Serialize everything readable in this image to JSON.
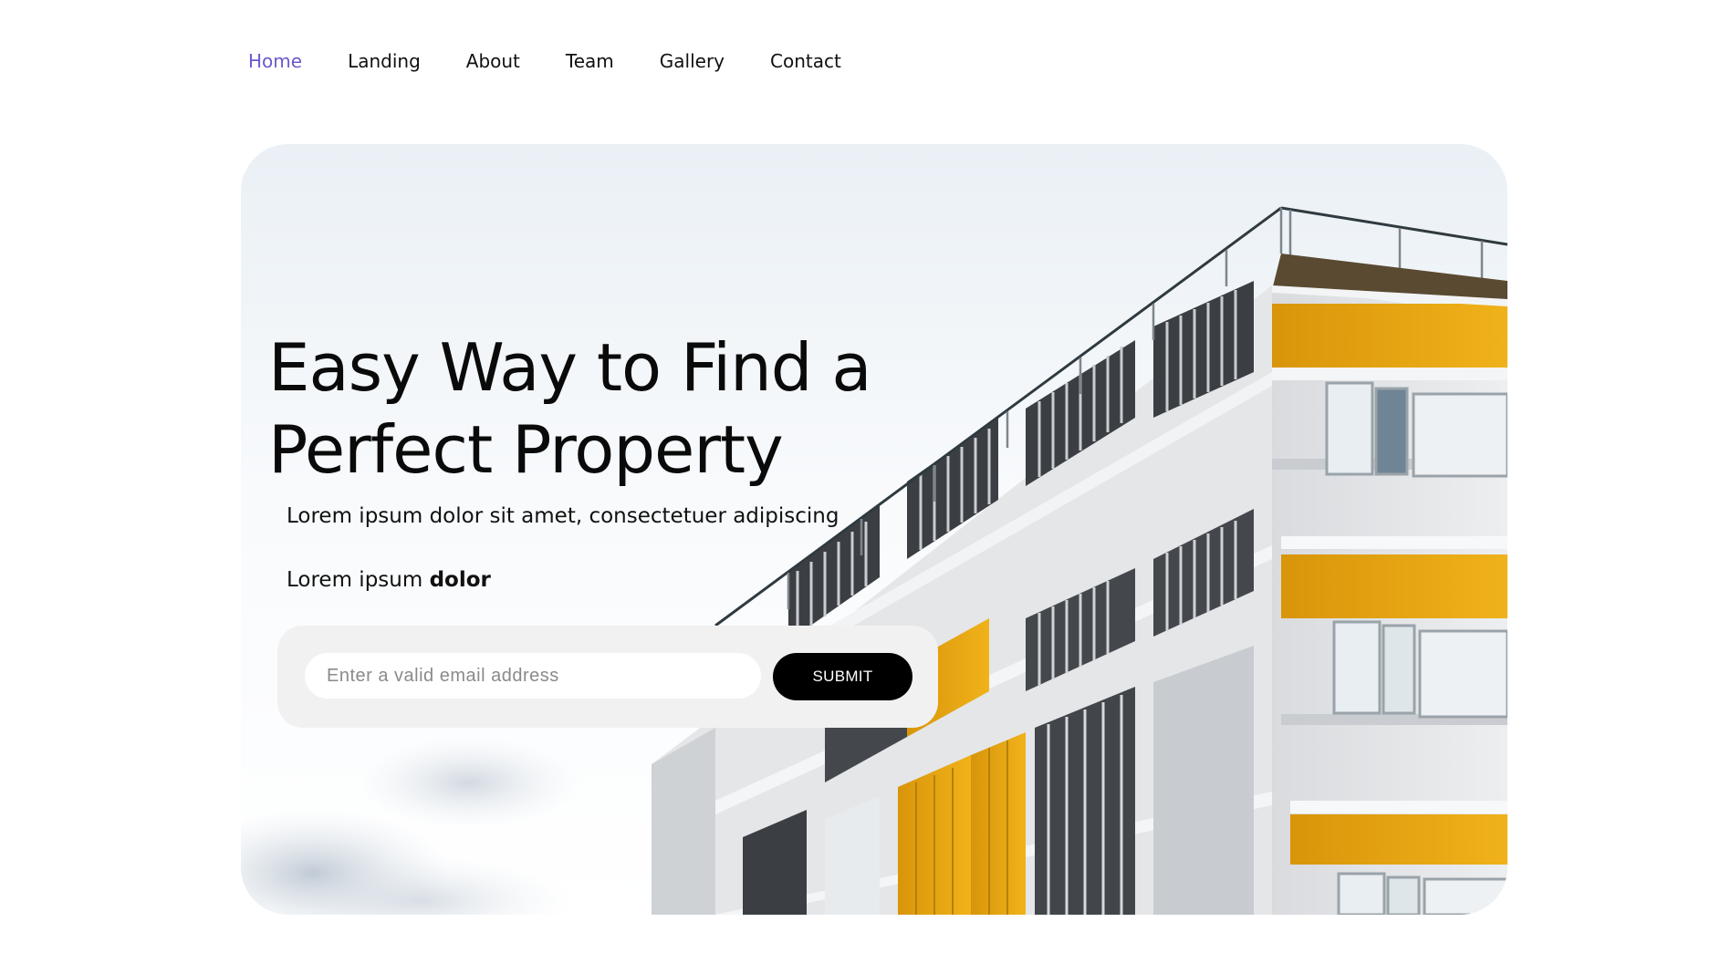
{
  "nav": {
    "items": [
      {
        "label": "Home",
        "active": true
      },
      {
        "label": "Landing",
        "active": false
      },
      {
        "label": "About",
        "active": false
      },
      {
        "label": "Team",
        "active": false
      },
      {
        "label": "Gallery",
        "active": false
      },
      {
        "label": "Contact",
        "active": false
      }
    ],
    "active_color": "#6a5acd"
  },
  "hero": {
    "title_line1": "Easy Way to Find a",
    "title_line2": "Perfect Property",
    "subtitle": "Lorem ipsum dolor sit amet, consectetuer adipiscing",
    "line2_prefix": "Lorem ipsum ",
    "line2_bold": "dolor",
    "image_subject": "modern-apartment-building"
  },
  "form": {
    "email_placeholder": "Enter a valid email address",
    "email_value": "",
    "submit_label": "SUBMIT"
  },
  "colors": {
    "accent": "#6a5acd",
    "button_bg": "#000000",
    "form_bg": "#f1f1f1",
    "facade_yellow": "#e9a90d"
  }
}
